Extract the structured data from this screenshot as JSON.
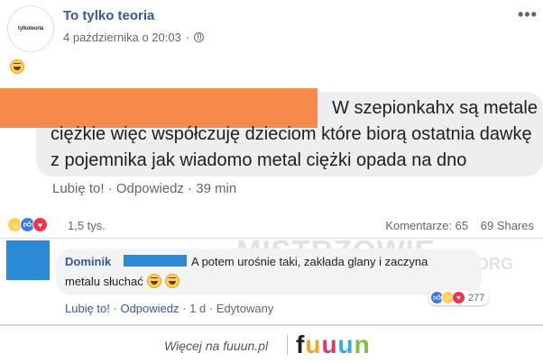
{
  "post": {
    "page_name": "To tylko teoria",
    "avatar_text": "tylkoteoria",
    "date": "4 października o 20:03",
    "more_menu": "•••",
    "emoji_name": "laughing-emoji"
  },
  "screenshot_comment": {
    "line1": "W szepionkahx są metale",
    "line2": "ciężkie więc współczuję dzieciom które biorą ostatnia dawkę",
    "line3": "z pojemnika jak wiadomo metal ciężki opada na dno",
    "actions": "Lubię to! · Odpowiedz · 39 min",
    "redaction_color": "#f58a4b"
  },
  "stats": {
    "reaction_count": "1,5 tys.",
    "comments": "Komentarze: 65",
    "shares": "69 Shares",
    "reaction_icons": [
      "haha",
      "like",
      "love"
    ]
  },
  "comment": {
    "author": "Dominik",
    "text_line1": "A potem urośnie taki, zakłada glany i zaczyna",
    "text_line2": "metalu słuchać",
    "reaction_count": "277",
    "like": "Lubię to!",
    "reply": "Odpowiedz",
    "time": "1 d",
    "edited": "Edytowany",
    "sep": "·",
    "redaction_color": "#2b8ad6"
  },
  "watermark": {
    "main": "MISTRZOWIE",
    "suffix": "ORG"
  },
  "footer": {
    "more_link": "Więcej na fuuun.pl",
    "logo_letters": [
      "f",
      "u",
      "u",
      "u",
      "n"
    ]
  }
}
